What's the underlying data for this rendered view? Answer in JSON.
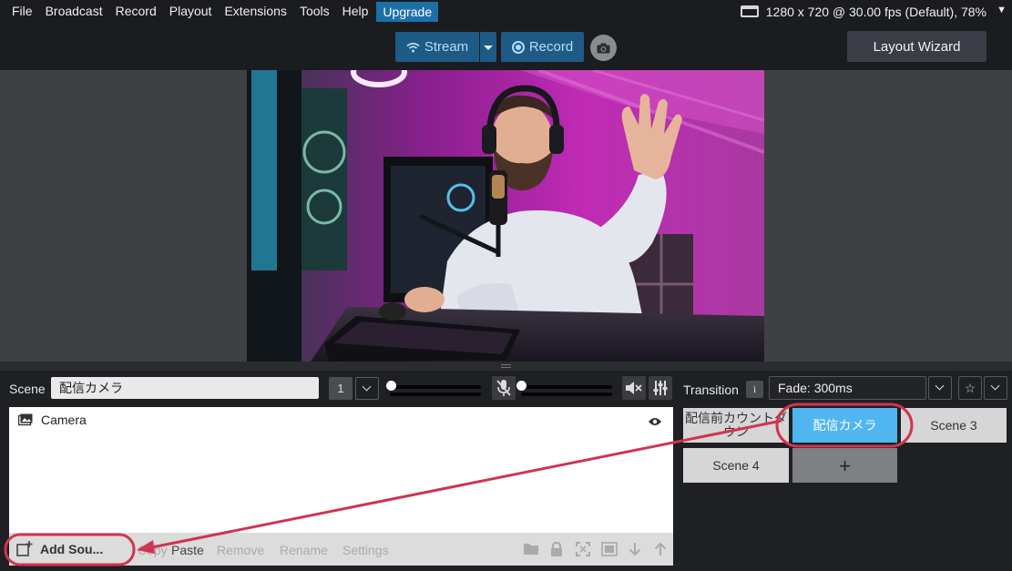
{
  "menu": [
    "File",
    "Broadcast",
    "Record",
    "Playout",
    "Extensions",
    "Tools",
    "Help"
  ],
  "menu_upgrade": "Upgrade",
  "resolution": "1280 x 720 @ 30.00 fps (Default), 78%",
  "toolbar": {
    "stream_label": "Stream",
    "record_label": "Record",
    "layout_wizard_label": "Layout Wizard"
  },
  "scene_bar": {
    "label": "Scene",
    "current_scene": "配信カメラ",
    "number": "1"
  },
  "audio": {
    "mic_level": 0,
    "desktop_level": 0
  },
  "sources": {
    "items": [
      {
        "name": "Camera",
        "visible": true
      }
    ],
    "add_label": "Add Sou...",
    "copy_label": "Copy",
    "paste_label": "Paste",
    "remove_label": "Remove",
    "rename_label": "Rename",
    "settings_label": "Settings"
  },
  "transition": {
    "label": "Transition",
    "info": "i",
    "value": "Fade: 300ms",
    "star": "☆"
  },
  "scenes": [
    {
      "name": "配信前カウントダウン",
      "active": false
    },
    {
      "name": "配信カメラ",
      "active": true
    },
    {
      "name": "Scene 3",
      "active": false
    },
    {
      "name": "Scene 4",
      "active": false
    }
  ],
  "add_scene_label": "+",
  "annotation_color": "#d0344f",
  "accent_color": "#4fb6ef",
  "button_color": "#1d5b86"
}
